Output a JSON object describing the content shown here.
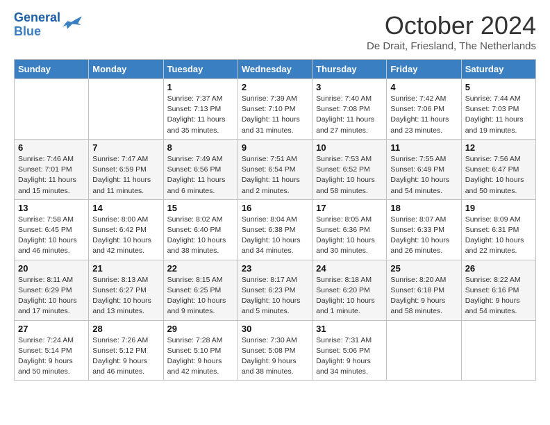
{
  "header": {
    "logo_line1": "General",
    "logo_line2": "Blue",
    "month": "October 2024",
    "location": "De Drait, Friesland, The Netherlands"
  },
  "weekdays": [
    "Sunday",
    "Monday",
    "Tuesday",
    "Wednesday",
    "Thursday",
    "Friday",
    "Saturday"
  ],
  "weeks": [
    [
      {
        "day": "",
        "info": ""
      },
      {
        "day": "",
        "info": ""
      },
      {
        "day": "1",
        "info": "Sunrise: 7:37 AM\nSunset: 7:13 PM\nDaylight: 11 hours and 35 minutes."
      },
      {
        "day": "2",
        "info": "Sunrise: 7:39 AM\nSunset: 7:10 PM\nDaylight: 11 hours and 31 minutes."
      },
      {
        "day": "3",
        "info": "Sunrise: 7:40 AM\nSunset: 7:08 PM\nDaylight: 11 hours and 27 minutes."
      },
      {
        "day": "4",
        "info": "Sunrise: 7:42 AM\nSunset: 7:06 PM\nDaylight: 11 hours and 23 minutes."
      },
      {
        "day": "5",
        "info": "Sunrise: 7:44 AM\nSunset: 7:03 PM\nDaylight: 11 hours and 19 minutes."
      }
    ],
    [
      {
        "day": "6",
        "info": "Sunrise: 7:46 AM\nSunset: 7:01 PM\nDaylight: 11 hours and 15 minutes."
      },
      {
        "day": "7",
        "info": "Sunrise: 7:47 AM\nSunset: 6:59 PM\nDaylight: 11 hours and 11 minutes."
      },
      {
        "day": "8",
        "info": "Sunrise: 7:49 AM\nSunset: 6:56 PM\nDaylight: 11 hours and 6 minutes."
      },
      {
        "day": "9",
        "info": "Sunrise: 7:51 AM\nSunset: 6:54 PM\nDaylight: 11 hours and 2 minutes."
      },
      {
        "day": "10",
        "info": "Sunrise: 7:53 AM\nSunset: 6:52 PM\nDaylight: 10 hours and 58 minutes."
      },
      {
        "day": "11",
        "info": "Sunrise: 7:55 AM\nSunset: 6:49 PM\nDaylight: 10 hours and 54 minutes."
      },
      {
        "day": "12",
        "info": "Sunrise: 7:56 AM\nSunset: 6:47 PM\nDaylight: 10 hours and 50 minutes."
      }
    ],
    [
      {
        "day": "13",
        "info": "Sunrise: 7:58 AM\nSunset: 6:45 PM\nDaylight: 10 hours and 46 minutes."
      },
      {
        "day": "14",
        "info": "Sunrise: 8:00 AM\nSunset: 6:42 PM\nDaylight: 10 hours and 42 minutes."
      },
      {
        "day": "15",
        "info": "Sunrise: 8:02 AM\nSunset: 6:40 PM\nDaylight: 10 hours and 38 minutes."
      },
      {
        "day": "16",
        "info": "Sunrise: 8:04 AM\nSunset: 6:38 PM\nDaylight: 10 hours and 34 minutes."
      },
      {
        "day": "17",
        "info": "Sunrise: 8:05 AM\nSunset: 6:36 PM\nDaylight: 10 hours and 30 minutes."
      },
      {
        "day": "18",
        "info": "Sunrise: 8:07 AM\nSunset: 6:33 PM\nDaylight: 10 hours and 26 minutes."
      },
      {
        "day": "19",
        "info": "Sunrise: 8:09 AM\nSunset: 6:31 PM\nDaylight: 10 hours and 22 minutes."
      }
    ],
    [
      {
        "day": "20",
        "info": "Sunrise: 8:11 AM\nSunset: 6:29 PM\nDaylight: 10 hours and 17 minutes."
      },
      {
        "day": "21",
        "info": "Sunrise: 8:13 AM\nSunset: 6:27 PM\nDaylight: 10 hours and 13 minutes."
      },
      {
        "day": "22",
        "info": "Sunrise: 8:15 AM\nSunset: 6:25 PM\nDaylight: 10 hours and 9 minutes."
      },
      {
        "day": "23",
        "info": "Sunrise: 8:17 AM\nSunset: 6:23 PM\nDaylight: 10 hours and 5 minutes."
      },
      {
        "day": "24",
        "info": "Sunrise: 8:18 AM\nSunset: 6:20 PM\nDaylight: 10 hours and 1 minute."
      },
      {
        "day": "25",
        "info": "Sunrise: 8:20 AM\nSunset: 6:18 PM\nDaylight: 9 hours and 58 minutes."
      },
      {
        "day": "26",
        "info": "Sunrise: 8:22 AM\nSunset: 6:16 PM\nDaylight: 9 hours and 54 minutes."
      }
    ],
    [
      {
        "day": "27",
        "info": "Sunrise: 7:24 AM\nSunset: 5:14 PM\nDaylight: 9 hours and 50 minutes."
      },
      {
        "day": "28",
        "info": "Sunrise: 7:26 AM\nSunset: 5:12 PM\nDaylight: 9 hours and 46 minutes."
      },
      {
        "day": "29",
        "info": "Sunrise: 7:28 AM\nSunset: 5:10 PM\nDaylight: 9 hours and 42 minutes."
      },
      {
        "day": "30",
        "info": "Sunrise: 7:30 AM\nSunset: 5:08 PM\nDaylight: 9 hours and 38 minutes."
      },
      {
        "day": "31",
        "info": "Sunrise: 7:31 AM\nSunset: 5:06 PM\nDaylight: 9 hours and 34 minutes."
      },
      {
        "day": "",
        "info": ""
      },
      {
        "day": "",
        "info": ""
      }
    ]
  ]
}
